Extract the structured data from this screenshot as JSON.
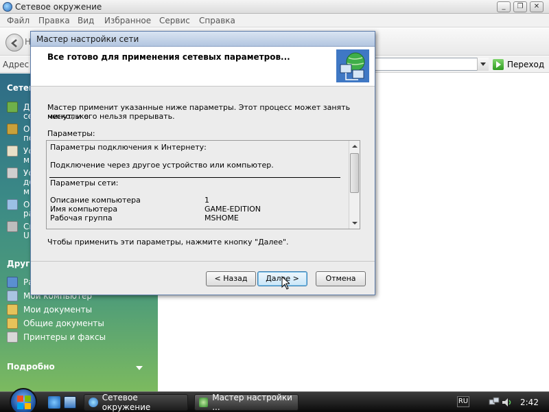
{
  "window": {
    "title": "Сетевое окружение",
    "controls": {
      "minimize": "_",
      "maximize": "❐",
      "close": "✕"
    }
  },
  "menubar": [
    "Файл",
    "Правка",
    "Вид",
    "Избранное",
    "Сервис",
    "Справка"
  ],
  "toolbar": {
    "back_label": "Н"
  },
  "addressbar": {
    "label": "Адрес",
    "go_label": "Переход"
  },
  "taskpane": {
    "section1": "Сетев",
    "section1_items": [
      {
        "label": "Д",
        "label2": "се",
        "icon": "network-tasks-icon"
      },
      {
        "label": "О",
        "label2": "по",
        "icon": "connections-icon"
      },
      {
        "label": "Ус",
        "label2": "м",
        "icon": "home-network-icon"
      },
      {
        "label": "Ус",
        "label2": "до",
        "label3": "м",
        "icon": "printer-share-icon"
      },
      {
        "label": "О",
        "label2": "ра",
        "icon": "computers-icon"
      },
      {
        "label": "Ск",
        "label2": "UF",
        "icon": "upnp-icon"
      }
    ],
    "section2": "Други",
    "section2_items": [
      {
        "label": "Ра",
        "icon": "desktop-icon"
      },
      {
        "label": "Мой компьютер",
        "icon": "my-computer-icon"
      },
      {
        "label": "Мои документы",
        "icon": "my-documents-icon"
      },
      {
        "label": "Общие документы",
        "icon": "shared-documents-icon"
      },
      {
        "label": "Принтеры и факсы",
        "icon": "printers-icon"
      }
    ],
    "section3": "Подробно"
  },
  "dialog": {
    "title": "Мастер настройки сети",
    "header": "Все готово для применения сетевых параметров...",
    "intro_line1": "Мастер применит указанные ниже параметры. Этот процесс может занять несколько",
    "intro_line2": "минут, и его нельзя прерывать.",
    "params_label": "Параметры:",
    "params": {
      "internet_header": "Параметры подключения к Интернету:",
      "internet_value": "Подключение через другое устройство или компьютер.",
      "network_header": "Параметры сети:",
      "rows": [
        {
          "name": "Описание компьютера",
          "value": "1"
        },
        {
          "name": "Имя компьютера",
          "value": "GAME-EDITION"
        },
        {
          "name": "Рабочая группа",
          "value": "MSHOME"
        }
      ]
    },
    "footer_text": "Чтобы применить эти параметры, нажмите кнопку \"Далее\".",
    "buttons": {
      "back": "< Назад",
      "next": "Далее >",
      "cancel": "Отмена"
    }
  },
  "taskbar": {
    "tasks": [
      {
        "label": "Сетевое окружение"
      },
      {
        "label": "Мастер настройки ..."
      }
    ],
    "language": "RU",
    "clock": "2:42"
  }
}
